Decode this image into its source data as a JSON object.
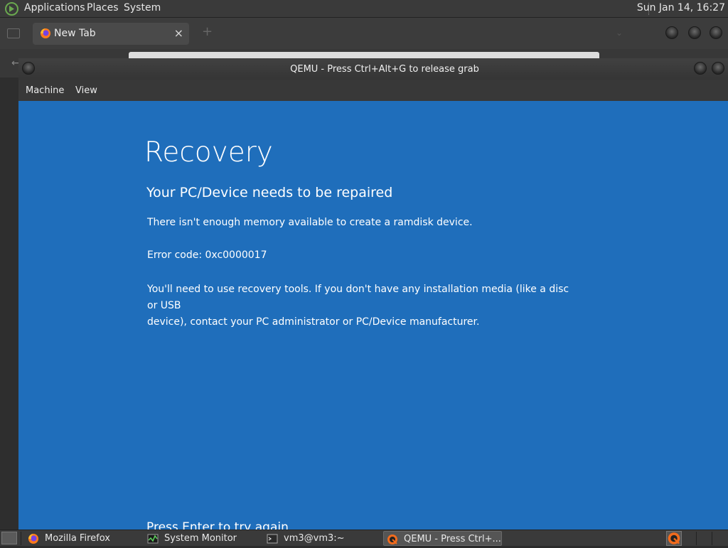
{
  "top_panel": {
    "menus": [
      "Applications",
      "Places",
      "System"
    ],
    "clock": "Sun Jan 14, 16:27"
  },
  "firefox": {
    "tab_label": "New Tab",
    "tab_close": "×",
    "new_tab": "+"
  },
  "qemu": {
    "title": "QEMU - Press Ctrl+Alt+G to release grab",
    "menus": [
      "Machine",
      "View"
    ]
  },
  "recovery": {
    "title": "Recovery",
    "subtitle": "Your PC/Device needs to be repaired",
    "message": "There isn't enough memory available to create a ramdisk device.",
    "error_code": "Error code: 0xc0000017",
    "tools_line1": "You'll need to use recovery tools. If you don't have any installation media (like a disc or USB",
    "tools_line2": "device), contact your PC administrator or PC/Device manufacturer.",
    "enter": "Press Enter to try again"
  },
  "taskbar": {
    "items": [
      {
        "label": "Mozilla Firefox",
        "icon": "firefox-icon"
      },
      {
        "label": "System Monitor",
        "icon": "system-monitor-icon"
      },
      {
        "label": "vm3@vm3:~",
        "icon": "terminal-icon"
      },
      {
        "label": "QEMU - Press Ctrl+...",
        "icon": "qemu-icon"
      }
    ]
  },
  "colors": {
    "recovery_bg": "#1f6ebb",
    "panel_bg": "#3a3a3a"
  }
}
